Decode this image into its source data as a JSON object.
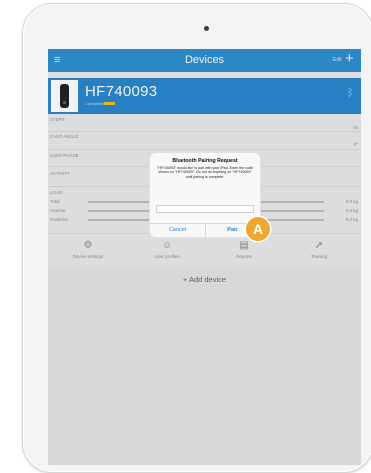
{
  "nav": {
    "menu_icon": "hamburger-icon",
    "title": "Devices",
    "edit_label": "Edit",
    "add_icon": "plus-icon"
  },
  "device": {
    "name": "HF740093",
    "status": "Connected",
    "battery_icon": "battery-icon",
    "bluetooth_icon": "bluetooth-icon",
    "accent_color": "#2a86cf"
  },
  "sections": {
    "steps_label": "STEPS",
    "steps_value": "0s",
    "cant_angle_label": "CANT ANGLE",
    "cant_angle_value": "0°",
    "cant_phase_label": "CANT PHASE",
    "activity_label": "ACTIVITY",
    "load_label": "LOAD",
    "load_rows": [
      {
        "label": "Total",
        "value": "0.0 kg"
      },
      {
        "label": "Anterior",
        "value": "0.0 kg"
      },
      {
        "label": "Posterior",
        "value": "0.0 kg"
      }
    ]
  },
  "tabs": [
    {
      "label": "Device settings",
      "icon": "gear-icon"
    },
    {
      "label": "User profiles",
      "icon": "user-icon"
    },
    {
      "label": "Reports",
      "icon": "report-icon"
    },
    {
      "label": "Training",
      "icon": "runner-icon"
    }
  ],
  "add_device_label": "+ Add device",
  "alert": {
    "title": "Bluetooth Pairing Request",
    "message": "\"HF740093\" would like to pair with your iPad. Enter the code shown on \"HF740093\". Do not do anything on \"HF740093\" until pairing is complete.",
    "input_value": "",
    "cancel_label": "Cancel",
    "pair_label": "Pair"
  },
  "callout": {
    "label": "A",
    "color": "#f0a830"
  }
}
